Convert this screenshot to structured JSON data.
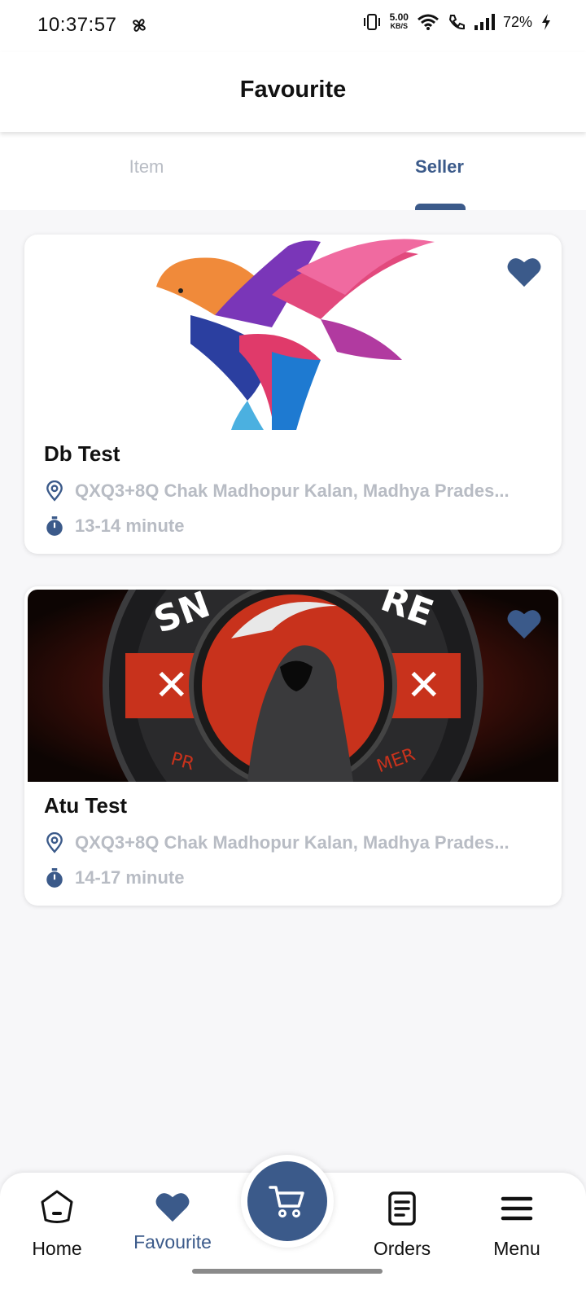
{
  "status_bar": {
    "time": "10:37:57",
    "net_speed_value": "5.00",
    "net_speed_unit": "KB/S",
    "battery": "72%"
  },
  "header": {
    "title": "Favourite"
  },
  "tabs": [
    {
      "label": "Item",
      "active": false
    },
    {
      "label": "Seller",
      "active": true
    }
  ],
  "sellers": [
    {
      "name": "Db Test",
      "address": "QXQ3+8Q Chak Madhopur Kalan, Madhya Prades...",
      "delivery_time": "13-14 minute",
      "favourite": true
    },
    {
      "name": "Atu Test",
      "address": "QXQ3+8Q Chak Madhopur Kalan, Madhya Prades...",
      "delivery_time": "14-17 minute",
      "favourite": true
    }
  ],
  "bottom_nav": {
    "home": "Home",
    "favourite": "Favourite",
    "orders": "Orders",
    "menu": "Menu"
  },
  "colors": {
    "accent": "#3b5a8a",
    "muted_text": "#b8bcc4",
    "background": "#f7f7f9"
  }
}
